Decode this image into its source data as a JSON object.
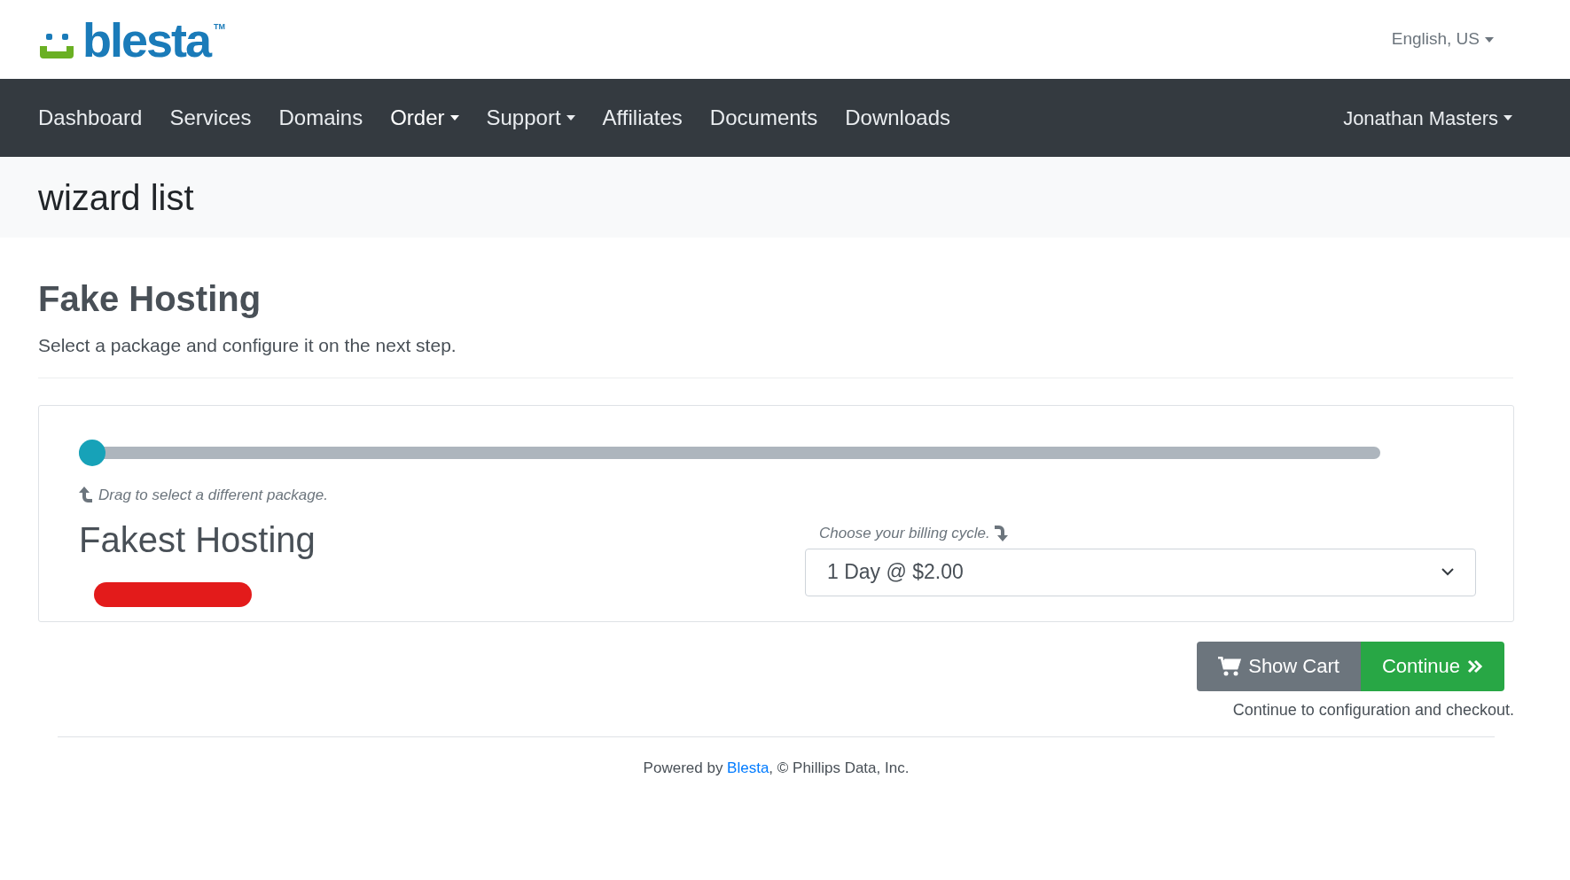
{
  "logo": {
    "text": "blesta",
    "mark": "TM"
  },
  "language": {
    "label": "English, US"
  },
  "nav": {
    "items": [
      {
        "label": "Dashboard",
        "dropdown": false,
        "selected": false
      },
      {
        "label": "Services",
        "dropdown": false,
        "selected": false
      },
      {
        "label": "Domains",
        "dropdown": false,
        "selected": false
      },
      {
        "label": "Order",
        "dropdown": true,
        "selected": true
      },
      {
        "label": "Support",
        "dropdown": true,
        "selected": false
      },
      {
        "label": "Affiliates",
        "dropdown": false,
        "selected": false
      },
      {
        "label": "Documents",
        "dropdown": false,
        "selected": false
      },
      {
        "label": "Downloads",
        "dropdown": false,
        "selected": false
      }
    ],
    "user": "Jonathan Masters"
  },
  "page_title": "wizard list",
  "group": {
    "title": "Fake Hosting",
    "description": "Select a package and configure it on the next step."
  },
  "package": {
    "slider": {
      "level": 0
    },
    "hint": "Drag to select a different package.",
    "name": "Fakest Hosting",
    "redacted": true,
    "billing": {
      "label": "Choose your billing cycle.",
      "value": "1 Day @ $2.00"
    }
  },
  "actions": {
    "buttons": [
      {
        "label": "Show Cart",
        "kind": "cart"
      },
      {
        "label": "Continue",
        "kind": "continue"
      }
    ],
    "note": "Continue to configuration and checkout."
  },
  "footer": {
    "prefix": "Powered by ",
    "link": "Blesta",
    "suffix": ", © Phillips Data, Inc."
  }
}
